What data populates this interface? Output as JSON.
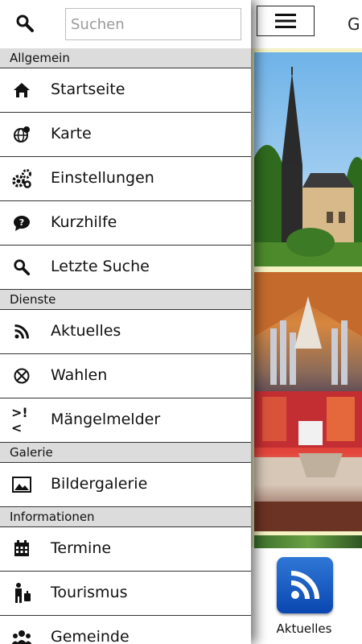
{
  "search": {
    "placeholder": "Suchen",
    "value": ""
  },
  "sections": [
    {
      "title": "Allgemein",
      "items": [
        {
          "label": "Startseite",
          "icon": "home-icon"
        },
        {
          "label": "Karte",
          "icon": "globe-pin-icon"
        },
        {
          "label": "Einstellungen",
          "icon": "gears-icon"
        },
        {
          "label": "Kurzhilfe",
          "icon": "help-bubble-icon"
        },
        {
          "label": "Letzte Suche",
          "icon": "search-icon"
        }
      ]
    },
    {
      "title": "Dienste",
      "items": [
        {
          "label": "Aktuelles",
          "icon": "rss-icon"
        },
        {
          "label": "Wahlen",
          "icon": "ballot-icon"
        },
        {
          "label": "Mängelmelder",
          "icon": "report-icon",
          "glyph": ">!<"
        }
      ]
    },
    {
      "title": "Galerie",
      "items": [
        {
          "label": "Bildergalerie",
          "icon": "picture-icon"
        }
      ]
    },
    {
      "title": "Informationen",
      "items": [
        {
          "label": "Termine",
          "icon": "calendar-icon"
        },
        {
          "label": "Tourismus",
          "icon": "traveler-icon"
        },
        {
          "label": "Gemeinde",
          "icon": "people-icon"
        }
      ]
    }
  ],
  "app": {
    "title_partial": "G",
    "tile_label": "Aktuelles"
  },
  "colors": {
    "tile": "#0a47b0",
    "section_bg": "#dcdcdc"
  }
}
